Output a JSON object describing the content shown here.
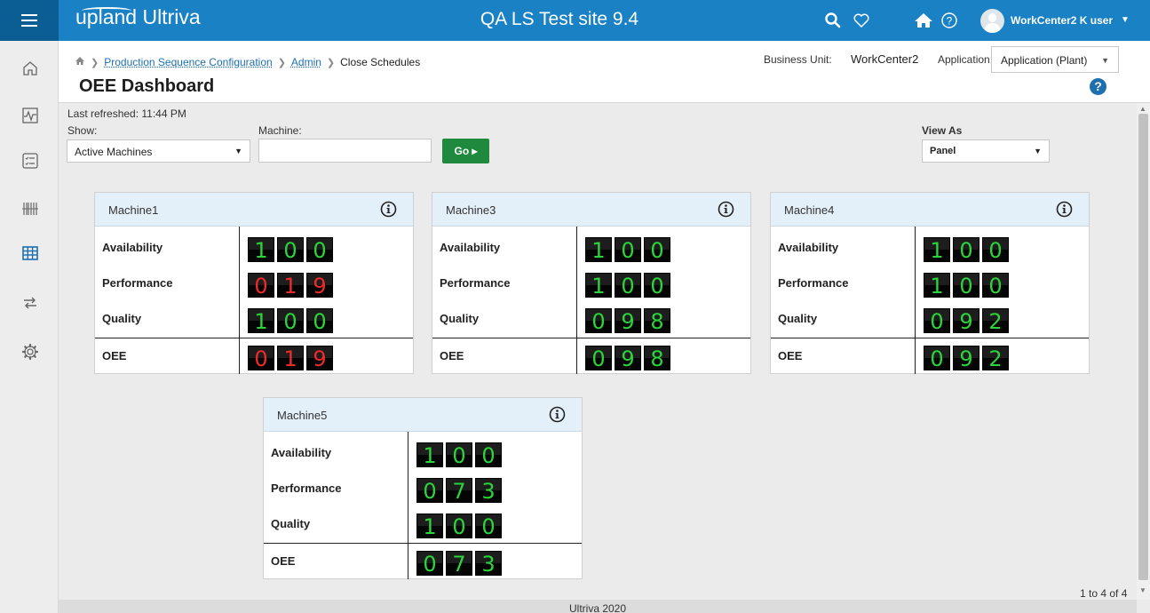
{
  "topbar": {
    "logo_text": "upland Ultriva",
    "title": "QA LS Test site 9.4",
    "icons": [
      "search-icon",
      "heart-icon",
      "home-icon",
      "help-circle-icon"
    ],
    "user_name": "WorkCenter2 K user",
    "user_caret": "▼"
  },
  "sidebar": {
    "icons": [
      "home-icon",
      "activity-icon",
      "checklist-icon",
      "barcode-icon",
      "grid-icon",
      "transfer-icon",
      "gear-icon"
    ],
    "active": "grid-icon",
    "active_color": "#1d6fb0"
  },
  "header": {
    "breadcrumb": {
      "home_icon": "home-icon",
      "items": [
        "Production Sequence Configuration",
        "Admin"
      ],
      "current": "Close Schedules"
    },
    "page_title": "OEE Dashboard",
    "business_unit_label": "Business Unit:",
    "business_unit_value": "WorkCenter2",
    "application_label": "Application:",
    "application_value": "Application (Plant)",
    "help_label": "?"
  },
  "filters": {
    "last_refreshed": "Last refreshed:  11:44 PM",
    "show_label": "Show:",
    "show_value": "Active Machines",
    "machine_label": "Machine:",
    "machine_value": "",
    "go_label": "Go ▸",
    "view_as_label": "View As",
    "view_as_value": "Panel"
  },
  "colors": {
    "topbar": "#1a82c4",
    "go_button": "#1f8a3e",
    "digit_good": "#2bd43a",
    "digit_bad": "#ef2a2a",
    "panel_header": "#e4f0f9"
  },
  "metric_labels": {
    "availability": "Availability",
    "performance": "Performance",
    "quality": "Quality",
    "oee": "OEE"
  },
  "machines": [
    {
      "name": "Machine1",
      "availability": {
        "d": [
          "1",
          "0",
          "0"
        ],
        "color": "g"
      },
      "performance": {
        "d": [
          "0",
          "1",
          "9"
        ],
        "color": "r"
      },
      "quality": {
        "d": [
          "1",
          "0",
          "0"
        ],
        "color": "g"
      },
      "oee": {
        "d": [
          "0",
          "1",
          "9"
        ],
        "color": "r"
      }
    },
    {
      "name": "Machine3",
      "availability": {
        "d": [
          "1",
          "0",
          "0"
        ],
        "color": "g"
      },
      "performance": {
        "d": [
          "1",
          "0",
          "0"
        ],
        "color": "g"
      },
      "quality": {
        "d": [
          "0",
          "9",
          "8"
        ],
        "color": "g"
      },
      "oee": {
        "d": [
          "0",
          "9",
          "8"
        ],
        "color": "g"
      }
    },
    {
      "name": "Machine4",
      "availability": {
        "d": [
          "1",
          "0",
          "0"
        ],
        "color": "g"
      },
      "performance": {
        "d": [
          "1",
          "0",
          "0"
        ],
        "color": "g"
      },
      "quality": {
        "d": [
          "0",
          "9",
          "2"
        ],
        "color": "g"
      },
      "oee": {
        "d": [
          "0",
          "9",
          "2"
        ],
        "color": "g"
      }
    },
    {
      "name": "Machine5",
      "availability": {
        "d": [
          "1",
          "0",
          "0"
        ],
        "color": "g"
      },
      "performance": {
        "d": [
          "0",
          "7",
          "3"
        ],
        "color": "g"
      },
      "quality": {
        "d": [
          "1",
          "0",
          "0"
        ],
        "color": "g"
      },
      "oee": {
        "d": [
          "0",
          "7",
          "3"
        ],
        "color": "g"
      }
    }
  ],
  "pager": "1 to 4 of 4",
  "footer": "Ultriva 2020"
}
